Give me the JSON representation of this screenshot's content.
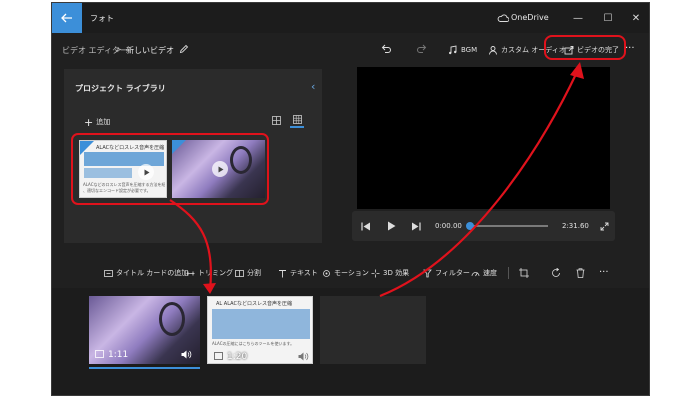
{
  "titlebar": {
    "app_title": "フォト",
    "onedrive_label": "OneDrive",
    "minimize": "—",
    "maximize": "☐",
    "close": "✕"
  },
  "commandbar": {
    "breadcrumb_parent": "ビデオ エディター",
    "breadcrumb_sep": ">",
    "breadcrumb_current": "新しいビデオ",
    "bgm_label": "BGM",
    "custom_audio_label": "カスタム オーディオ",
    "finish_video_label": "ビデオの完了",
    "more": "···"
  },
  "library": {
    "title": "プロジェクト ライブラリ",
    "add_label": "追加",
    "add_icon_glyph": "+",
    "collapse_glyph": "‹",
    "clip1": {
      "doc_title": "ALACなどロスレス音声を圧縮",
      "doc_text1": "ALACなどのロスレス音声を圧縮する方法を紹介します。品質を保つためには",
      "doc_text2": "、適切なエンコード設定が必要です。"
    }
  },
  "player": {
    "time_current": "0:00.00",
    "time_total": "2:31.60",
    "progress": 0
  },
  "storyboard_toolbar": {
    "add_title_card": "タイトル カードの追加",
    "trim": "トリミング",
    "split": "分割",
    "text": "テキスト",
    "motion": "モーション",
    "effects_3d": "3D 効果",
    "filter": "フィルター",
    "speed": "速度",
    "more": "···"
  },
  "storyboard": {
    "clips": [
      {
        "duration": "1:11",
        "selected": true
      },
      {
        "duration": "1:20",
        "selected": false,
        "doc_title": "AL ALACなどロスレス音声を圧縮",
        "doc_text": "ALACの圧縮にはこちらのツールを使います。"
      }
    ]
  },
  "colors": {
    "accent": "#3c8fd9",
    "highlight_red": "#e0121c",
    "window_bg": "#202020",
    "panel_bg": "#2b2b2b"
  }
}
